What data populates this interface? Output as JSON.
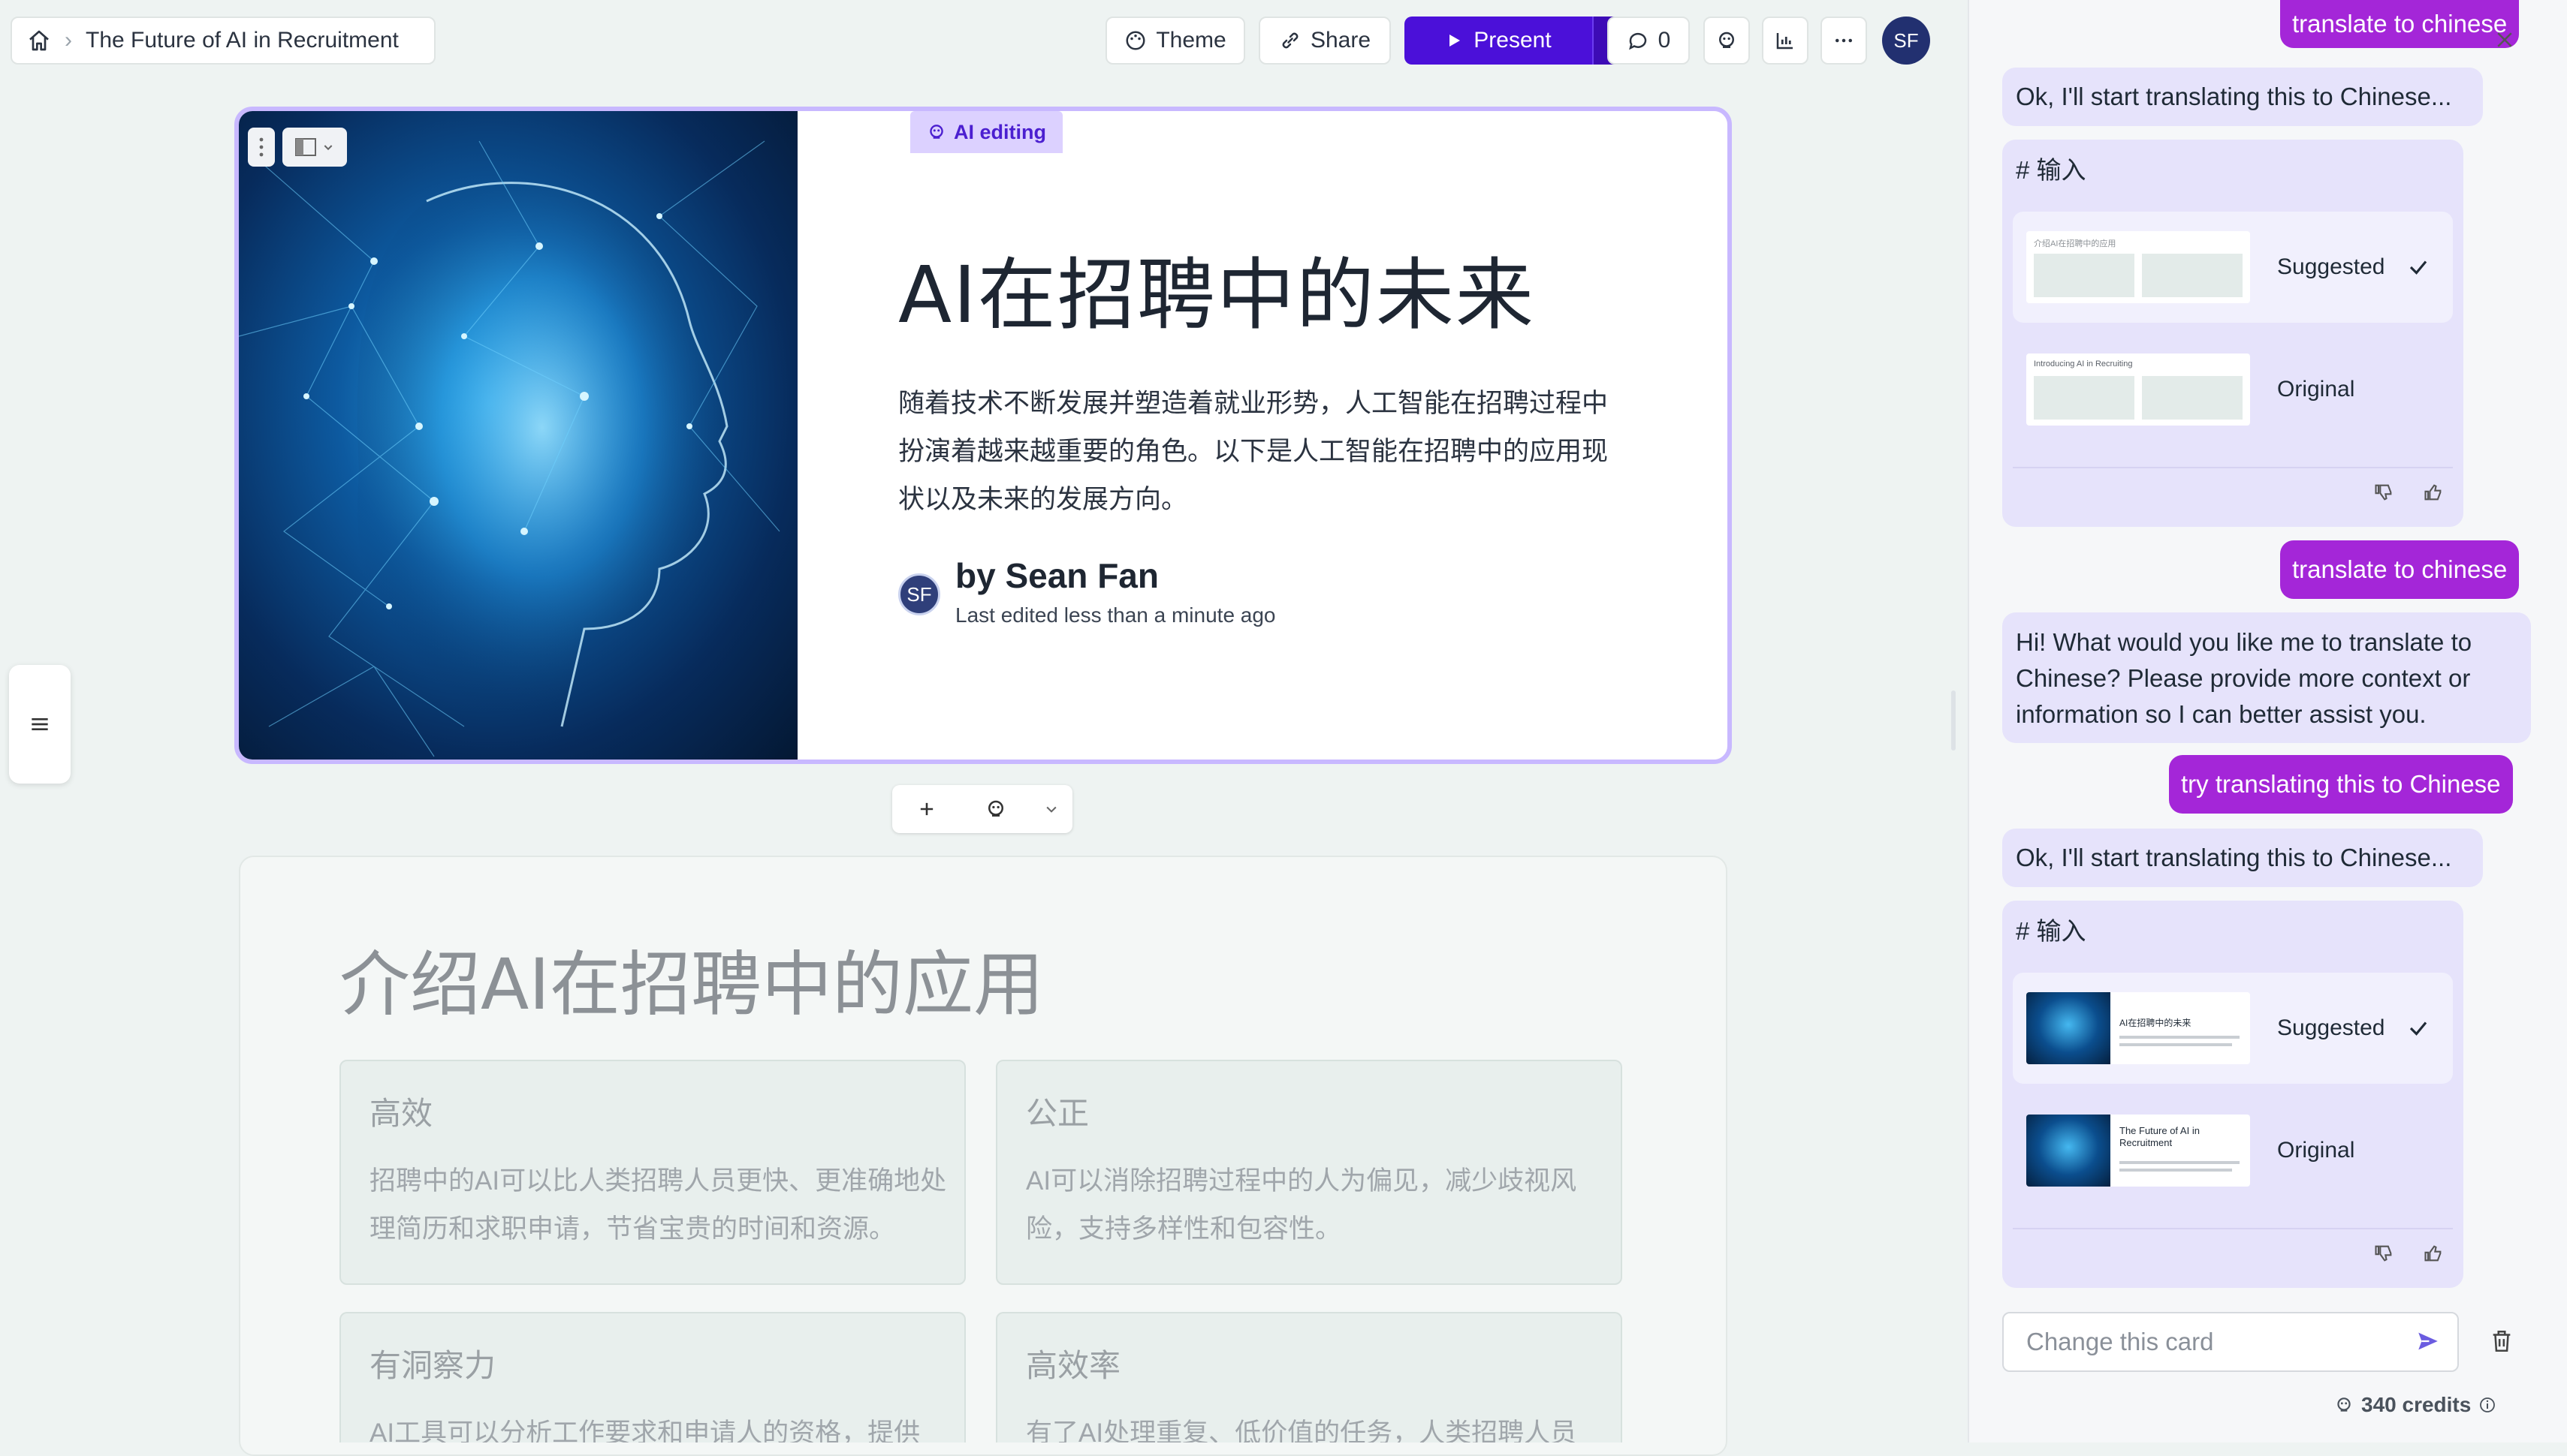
{
  "header": {
    "breadcrumb_title": "The Future of AI in Recruitment",
    "theme_label": "Theme",
    "share_label": "Share",
    "present_label": "Present",
    "comments_count": "0",
    "avatar_initials": "SF"
  },
  "title_card": {
    "ai_editing_label": "AI editing",
    "title": "AI在招聘中的未来",
    "body": "随着技术不断发展并塑造着就业形势，人工智能在招聘过程中扮演着越来越重要的角色。以下是人工智能在招聘中的应用现状以及未来的发展方向。",
    "author_initials": "SF",
    "author_name": "by Sean Fan",
    "edited_text": "Last edited less than a minute ago"
  },
  "second_card": {
    "title": "介绍AI在招聘中的应用",
    "features": [
      {
        "heading": "高效",
        "body": "招聘中的AI可以比人类招聘人员更快、更准确地处理简历和求职申请，节省宝贵的时间和资源。"
      },
      {
        "heading": "公正",
        "body": "AI可以消除招聘过程中的人为偏见，减少歧视风险，支持多样性和包容性。"
      },
      {
        "heading": "有洞察力",
        "body": "AI工具可以分析工作要求和申请人的资格，提供"
      },
      {
        "heading": "高效率",
        "body": "有了AI处理重复、低价值的任务，人类招聘人员"
      }
    ]
  },
  "chat": {
    "msg1_user": "translate to chinese",
    "msg2_ai": "Ok, I'll start translating this to Chinese...",
    "result1": {
      "heading": "# 输入",
      "suggested_label": "Suggested",
      "original_label": "Original",
      "thumb_suggested_title": "介绍AI在招聘中的应用",
      "thumb_original_title": "Introducing AI in Recruiting"
    },
    "msg3_user": "translate to chinese",
    "msg4_ai": "Hi! What would you like me to translate to Chinese? Please provide more context or information so I can better assist you.",
    "msg5_user": "try translating this to Chinese",
    "msg6_ai": "Ok, I'll start translating this to Chinese...",
    "result2": {
      "heading": "# 输入",
      "suggested_label": "Suggested",
      "original_label": "Original",
      "thumb_suggested_title": "AI在招聘中的未来",
      "thumb_original_title": "The Future of AI in Recruitment"
    },
    "input_placeholder": "Change this card",
    "credits": "340 credits"
  }
}
